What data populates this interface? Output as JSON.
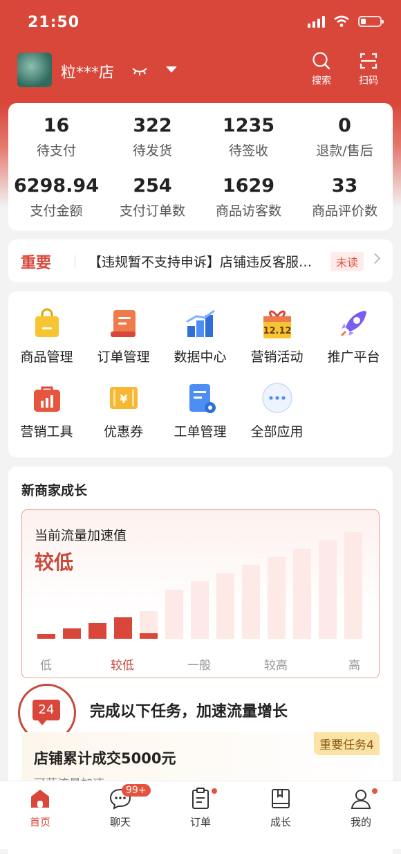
{
  "status": {
    "time": "21:50"
  },
  "header": {
    "store_name": "粒***店",
    "search_label": "搜索",
    "scan_label": "扫码"
  },
  "stats": [
    {
      "value": "16",
      "label": "待支付"
    },
    {
      "value": "322",
      "label": "待发货"
    },
    {
      "value": "1235",
      "label": "待签收"
    },
    {
      "value": "0",
      "label": "退款/售后"
    },
    {
      "value": "6298.94",
      "label": "支付金额"
    },
    {
      "value": "254",
      "label": "支付订单数"
    },
    {
      "value": "1629",
      "label": "商品访客数"
    },
    {
      "value": "33",
      "label": "商品评价数"
    }
  ],
  "notice": {
    "tag": "重要",
    "text": "【违规暂不支持申诉】店铺违反客服…",
    "status": "未读"
  },
  "apps": [
    {
      "label": "商品管理",
      "icon": "shopping-bag-icon"
    },
    {
      "label": "订单管理",
      "icon": "order-scroll-icon"
    },
    {
      "label": "数据中心",
      "icon": "bar-chart-icon"
    },
    {
      "label": "营销活动",
      "icon": "gift-1212-icon"
    },
    {
      "label": "推广平台",
      "icon": "rocket-icon"
    },
    {
      "label": "营销工具",
      "icon": "toolbox-icon"
    },
    {
      "label": "优惠券",
      "icon": "coupon-icon"
    },
    {
      "label": "工单管理",
      "icon": "ticket-doc-icon"
    },
    {
      "label": "全部应用",
      "icon": "more-icon"
    }
  ],
  "growth": {
    "title": "新商家成长",
    "accel_label": "当前流量加速值",
    "accel_value": "较低",
    "levels": [
      "低",
      "较低",
      "一般",
      "较高",
      "高"
    ],
    "current_level": "较低",
    "bar_values": [
      1,
      2,
      3,
      4,
      5,
      6,
      7,
      8,
      9,
      10,
      11,
      12,
      13
    ],
    "filled_bars": 5,
    "task_count": "24",
    "task_head": "完成以下任务，加速流量增长",
    "task_badge": "重要任务4",
    "task_name": "店铺累计成交5000元",
    "task_sub": "可获流量加速"
  },
  "tabs": [
    {
      "label": "首页",
      "active": true
    },
    {
      "label": "聊天",
      "badge": "99+"
    },
    {
      "label": "订单",
      "dot": true
    },
    {
      "label": "成长"
    },
    {
      "label": "我的",
      "dot": true
    }
  ],
  "colors": {
    "brand": "#d9473a",
    "accent_light": "#fdecea",
    "text": "#222222"
  }
}
